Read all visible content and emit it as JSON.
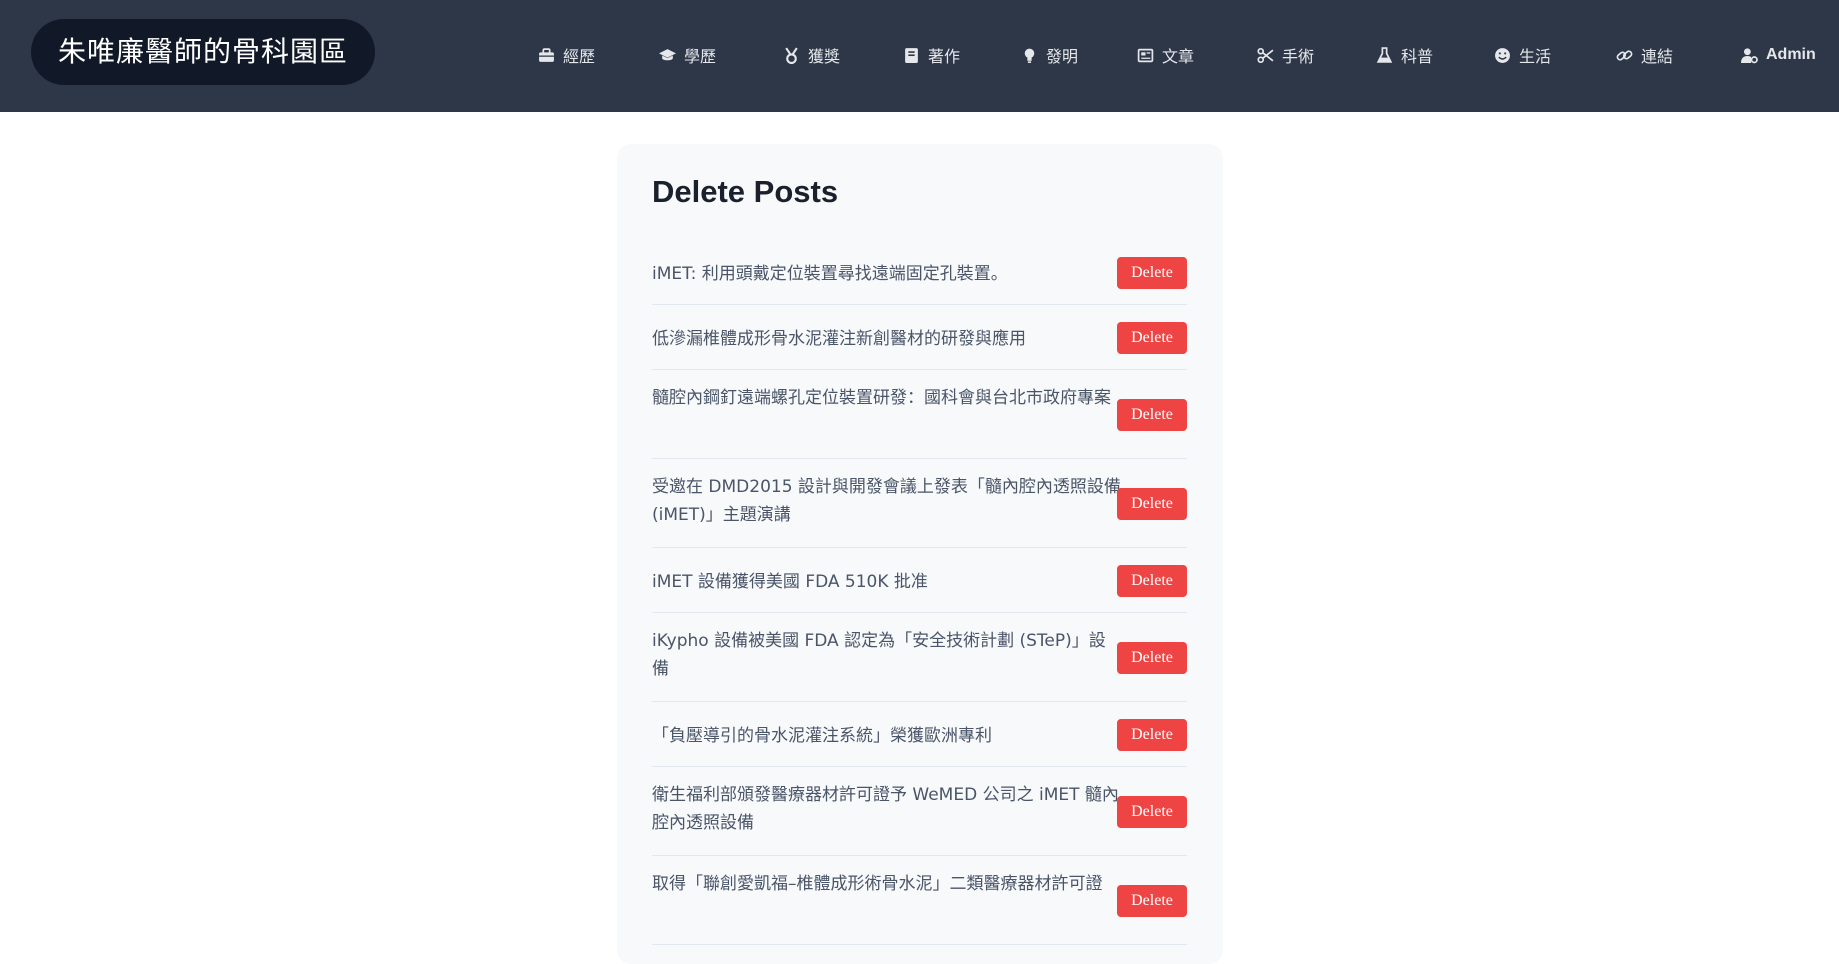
{
  "brand": {
    "title": "朱唯廉醫師的骨科園區"
  },
  "nav": [
    {
      "label": "經歷",
      "icon": "briefcase-icon"
    },
    {
      "label": "學歷",
      "icon": "graduation-cap-icon"
    },
    {
      "label": "獲獎",
      "icon": "medal-icon"
    },
    {
      "label": "著作",
      "icon": "book-icon"
    },
    {
      "label": "發明",
      "icon": "lightbulb-icon"
    },
    {
      "label": "文章",
      "icon": "newspaper-icon"
    },
    {
      "label": "手術",
      "icon": "scissors-icon"
    },
    {
      "label": "科普",
      "icon": "flask-icon"
    },
    {
      "label": "生活",
      "icon": "smile-icon"
    },
    {
      "label": "連結",
      "icon": "link-icon"
    },
    {
      "label": "Admin",
      "icon": "user-gear-icon"
    }
  ],
  "page": {
    "heading": "Delete Posts"
  },
  "posts": [
    {
      "title": "iMET: 利用頭戴定位裝置尋找遠端固定孔裝置。",
      "action": "Delete"
    },
    {
      "title": "低滲漏椎體成形骨水泥灌注新創醫材的研發與應用",
      "action": "Delete"
    },
    {
      "title": "髓腔內鋼釘遠端螺孔定位裝置研發：國科會與台北市政府專案",
      "action": "Delete"
    },
    {
      "title": "受邀在 DMD2015 設計與開發會議上發表「髓內腔內透照設備 (iMET)」主題演講",
      "action": "Delete"
    },
    {
      "title": "iMET 設備獲得美國 FDA 510K 批准",
      "action": "Delete"
    },
    {
      "title": "iKypho 設備被美國 FDA 認定為「安全技術計劃 (STeP)」設備",
      "action": "Delete"
    },
    {
      "title": "「負壓導引的骨水泥灌注系統」榮獲歐洲專利",
      "action": "Delete"
    },
    {
      "title": "衛生福利部頒發醫療器材許可證予 WeMED 公司之 iMET 髓內腔內透照設備",
      "action": "Delete"
    },
    {
      "title": "取得「聯創愛凱福–椎體成形術骨水泥」二類醫療器材許可證",
      "action": "Delete"
    }
  ]
}
